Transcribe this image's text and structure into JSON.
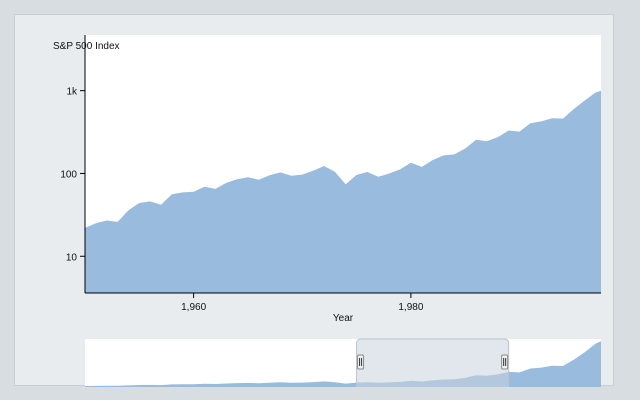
{
  "chart_data": {
    "type": "area",
    "ylabel": "S&P 500 Index",
    "xlabel": "Year",
    "yscale": "log",
    "ylim": [
      3.6,
      4700
    ],
    "xlim": [
      1950,
      1997.5
    ],
    "yticks": [
      10,
      100,
      1000
    ],
    "ytick_labels": [
      "10",
      "100",
      "1k"
    ],
    "xticks": [
      1960,
      1980
    ],
    "xtick_labels": [
      "1,960",
      "1,980"
    ],
    "color": "#99bbdd",
    "brush_range": [
      1975,
      1989
    ],
    "series": [
      {
        "x": [
          1950,
          1951,
          1952,
          1953,
          1954,
          1955,
          1956,
          1957,
          1958,
          1959,
          1960,
          1961,
          1962,
          1963,
          1964,
          1965,
          1966,
          1967,
          1968,
          1969,
          1970,
          1971,
          1972,
          1973,
          1974,
          1975,
          1976,
          1977,
          1978,
          1979,
          1980,
          1981,
          1982,
          1983,
          1984,
          1985,
          1986,
          1987,
          1988,
          1989,
          1990,
          1991,
          1992,
          1993,
          1994,
          1995,
          1996,
          1997,
          1997.5
        ],
        "values": [
          22,
          25,
          27,
          26,
          36,
          44,
          46,
          42,
          56,
          59,
          60,
          69,
          65,
          77,
          85,
          90,
          84,
          95,
          103,
          94,
          97,
          108,
          123,
          105,
          74,
          96,
          104,
          91,
          100,
          112,
          135,
          120,
          145,
          165,
          170,
          200,
          255,
          245,
          275,
          330,
          320,
          405,
          425,
          465,
          460,
          600,
          760,
          950,
          1000
        ]
      }
    ]
  }
}
